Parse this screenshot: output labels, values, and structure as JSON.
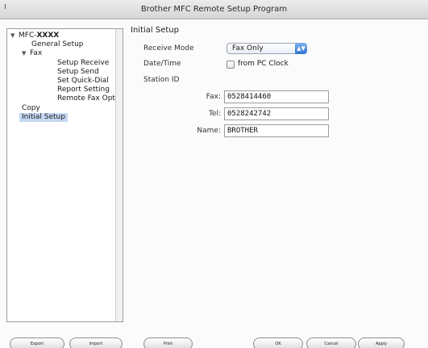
{
  "window": {
    "title": "Brother MFC Remote Setup Program"
  },
  "tree": {
    "root_prefix": "MFC-",
    "root_name": "XXXX",
    "items": [
      "General Setup",
      "Fax",
      "Setup Receive",
      "Setup Send",
      "Set Quick-Dial",
      "Report Setting",
      "Remote Fax Opt",
      "Copy",
      "Initial Setup"
    ]
  },
  "panel": {
    "heading": "Initial Setup",
    "receive_mode_label": "Receive Mode",
    "receive_mode_value": "Fax Only",
    "datetime_label": "Date/Time",
    "datetime_checkbox_label": "from PC Clock",
    "station_id_label": "Station ID",
    "fax_label": "Fax:",
    "fax_value": "0528414460",
    "tel_label": "Tel:",
    "tel_value": "0528242742",
    "name_label": "Name:",
    "name_value": "BROTHER"
  },
  "buttons": {
    "export": "Export",
    "import": "Import",
    "print": "Print",
    "ok": "OK",
    "cancel": "Cancel",
    "apply": "Apply"
  }
}
